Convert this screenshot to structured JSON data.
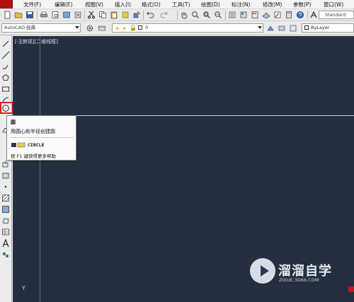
{
  "menubar": {
    "items": [
      "文件(F)",
      "编辑(E)",
      "视图(V)",
      "插入(I)",
      "格式(O)",
      "工具(T)",
      "绘图(D)",
      "标注(N)",
      "修改(M)",
      "参数(P)",
      "窗口(W)"
    ]
  },
  "toolbar": {
    "text_style": "Standard"
  },
  "properties_bar": {
    "workspace": "AutoCAD 经典",
    "layer": "0",
    "color": "ByLayer"
  },
  "canvas": {
    "viewport_label": "[-][俯视][二维线框]",
    "ucs_axis_label": "Y",
    "background_color": "#243040"
  },
  "tooltip": {
    "title": "圆",
    "description": "用圆心和半径创建圆",
    "command": "CIRCLE",
    "help_hint": "按 F1 键获得更多帮助"
  },
  "watermark": {
    "title": "溜溜自学",
    "subtitle": "ZIXUE.3D66.COM"
  },
  "colors": {
    "highlight": "#e01b1b",
    "app_icon": "#b01010"
  }
}
